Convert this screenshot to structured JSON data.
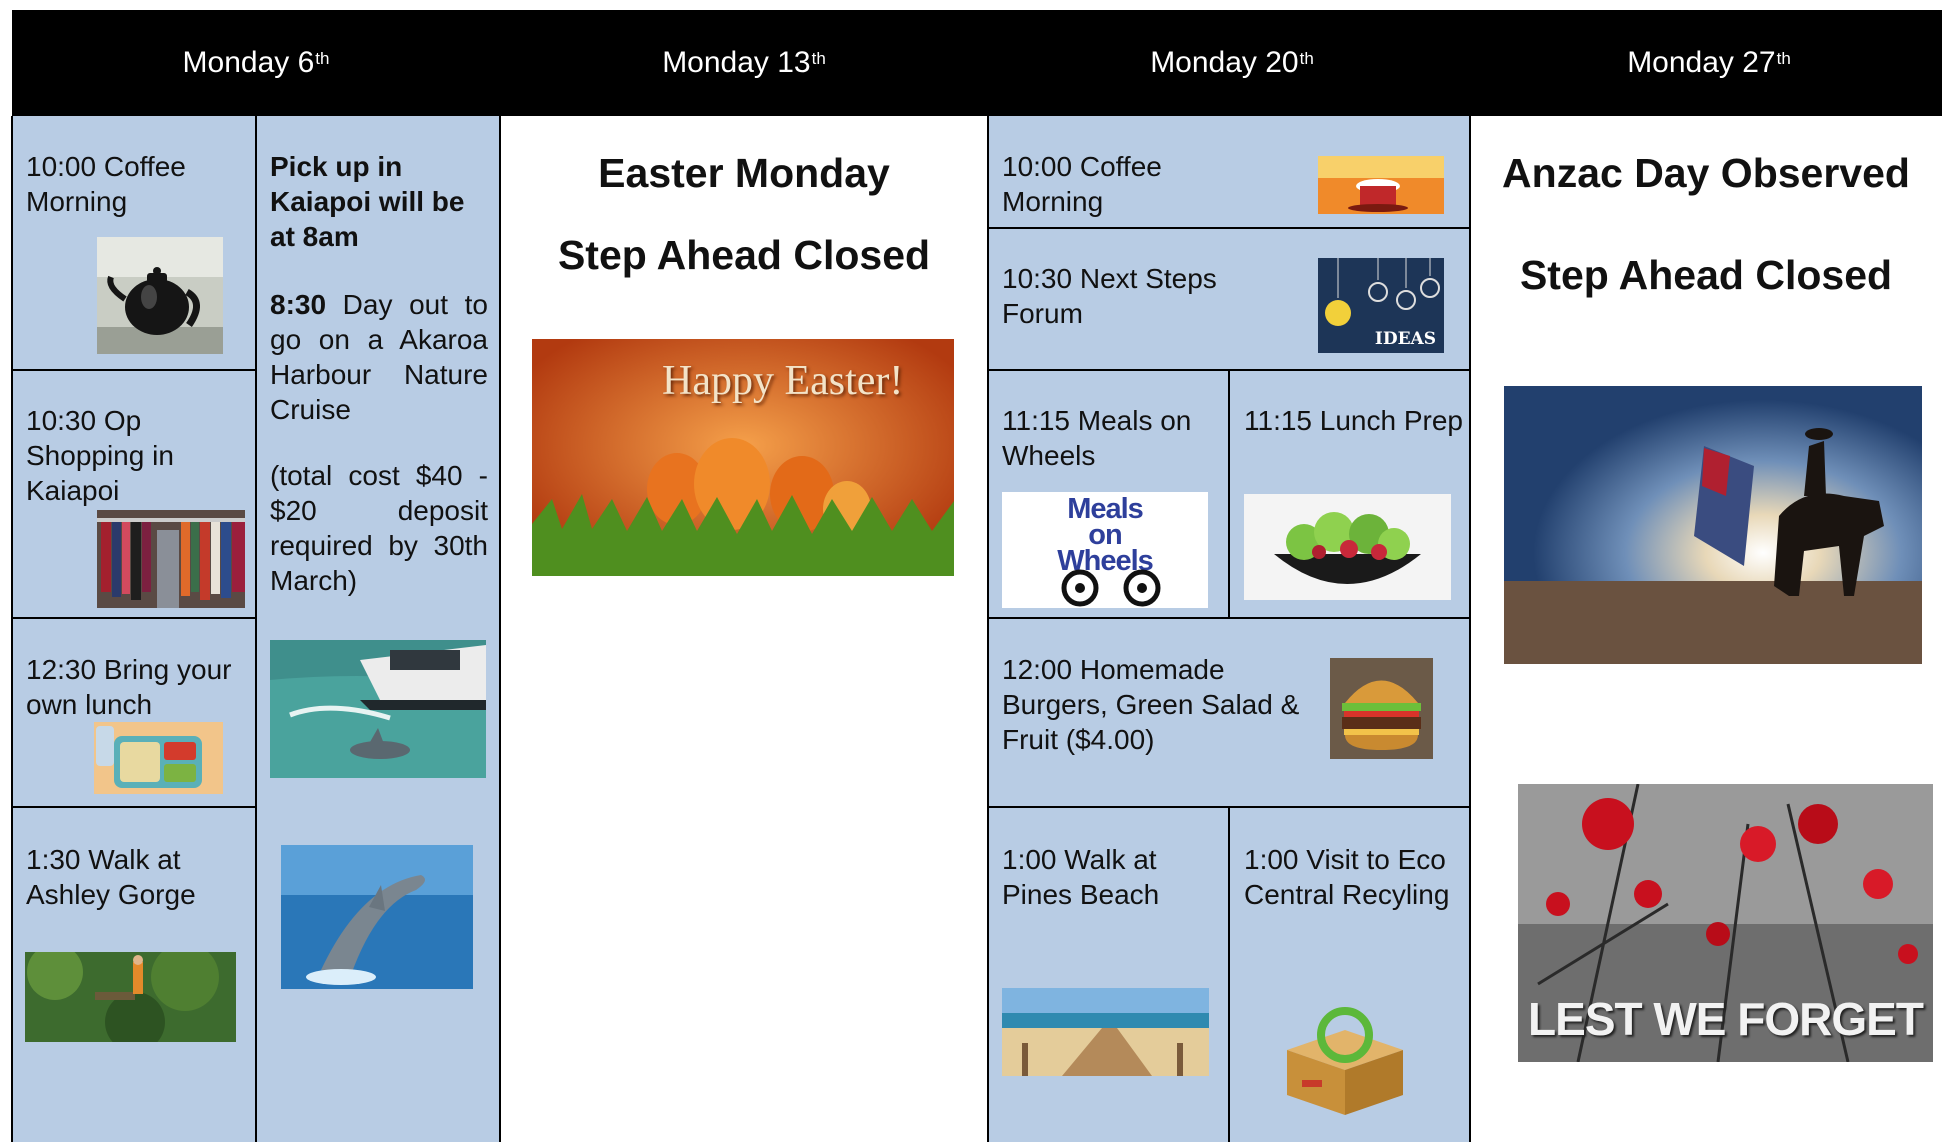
{
  "columns": [
    {
      "day": "Monday 6",
      "suffix": "th"
    },
    {
      "day": "Monday 13",
      "suffix": "th"
    },
    {
      "day": "Monday 20",
      "suffix": "th"
    },
    {
      "day": "Monday 27",
      "suffix": "th"
    }
  ],
  "week1": {
    "coffee": "10:00 Coffee Morning",
    "shopping": "10:30 Op Shopping in Kaiapoi",
    "lunch": "12:30 Bring your own lunch",
    "walk": "1:30 Walk at Ashley Gorge",
    "pickup": "Pick up in Kaiapoi will be at 8am",
    "dayout_time": "8:30",
    "dayout_text": "Day out to go on a Akaroa Harbour Nature Cruise",
    "cost": "(total cost $40 - $20 deposit required by 30th March)"
  },
  "week2": {
    "title": "Easter Monday",
    "closed": "Step Ahead Closed",
    "image_text": "Happy Easter!"
  },
  "week3": {
    "coffee": "10:00 Coffee Morning",
    "forum": "10:30 Next Steps Forum",
    "forum_image_text": "IDEAS",
    "meals": "11:15 Meals on Wheels",
    "meals_logo": [
      "Meals",
      "on",
      "Wheels"
    ],
    "prep": "11:15 Lunch Prep",
    "burgers": "12:00 Homemade Burgers, Green Salad & Fruit ($4.00)",
    "walk": "1:00 Walk at Pines Beach",
    "eco": "1:00 Visit to Eco Central Recyling"
  },
  "week4": {
    "title": "Anzac Day Observed",
    "closed": "Step Ahead Closed",
    "image_text": "LEST WE FORGET"
  },
  "colors": {
    "cell_blue": "#b8cce4",
    "header": "#000000",
    "header_text": "#ffffff"
  }
}
